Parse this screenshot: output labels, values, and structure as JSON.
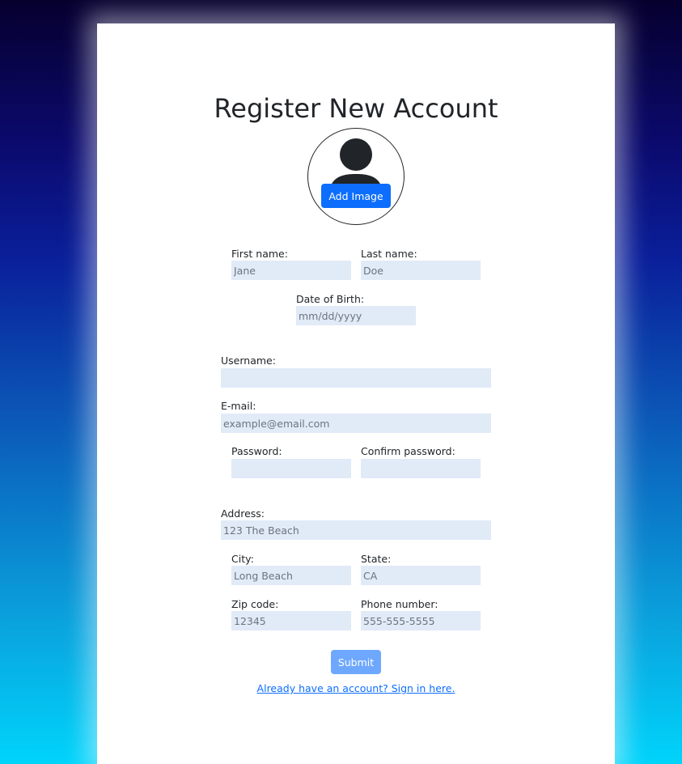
{
  "page": {
    "title": "Register New Account"
  },
  "avatar": {
    "icon": "person-silhouette-icon",
    "add_image_label": "Add Image"
  },
  "form": {
    "first_name": {
      "label": "First name:",
      "placeholder": "Jane"
    },
    "last_name": {
      "label": "Last name:",
      "placeholder": "Doe"
    },
    "dob": {
      "label": "Date of Birth:",
      "placeholder": "mm/dd/yyyy"
    },
    "username": {
      "label": "Username:",
      "placeholder": ""
    },
    "email": {
      "label": "E-mail:",
      "placeholder": "example@email.com"
    },
    "password": {
      "label": "Password:",
      "placeholder": ""
    },
    "confirm_password": {
      "label": "Confirm password:",
      "placeholder": ""
    },
    "address": {
      "label": "Address:",
      "placeholder": "123 The Beach"
    },
    "city": {
      "label": "City:",
      "placeholder": "Long Beach"
    },
    "state": {
      "label": "State:",
      "placeholder": "CA"
    },
    "zip": {
      "label": "Zip code:",
      "placeholder": "12345"
    },
    "phone": {
      "label": "Phone number:",
      "placeholder": "555-555-5555"
    },
    "submit_label": "Submit",
    "signin_link": "Already have an account? Sign in here."
  },
  "colors": {
    "primary": "#0d6efd",
    "submit_disabled": "#6ea8fe",
    "input_bg": "#e1eaf7",
    "text": "#212529"
  }
}
